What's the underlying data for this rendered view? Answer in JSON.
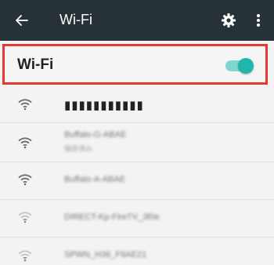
{
  "appbar": {
    "title": "Wi-Fi",
    "back_icon": "back-arrow-icon",
    "settings_icon": "gear-icon",
    "more_icon": "more-vertical-icon",
    "background": "#263238"
  },
  "wifi_master": {
    "label": "Wi-Fi",
    "state": "on",
    "highlight_color": "#e53935",
    "toggle_color": "#1fb7ad"
  },
  "networks": [
    {
      "name": "▮▮▮▮▮▮▮▮▮▮▮",
      "subtitle": "",
      "signal": "strong"
    },
    {
      "name": "Buffalo-G-ABAE",
      "subtitle": "保存済み",
      "signal": "strong"
    },
    {
      "name": "Buffalo-A-ABAE",
      "subtitle": "",
      "signal": "strong"
    },
    {
      "name": "DIRECT-Kp-FireTV_3f0e",
      "subtitle": "",
      "signal": "weak"
    },
    {
      "name": "SPWN_H36_F9AE21",
      "subtitle": "",
      "signal": "weak"
    }
  ]
}
